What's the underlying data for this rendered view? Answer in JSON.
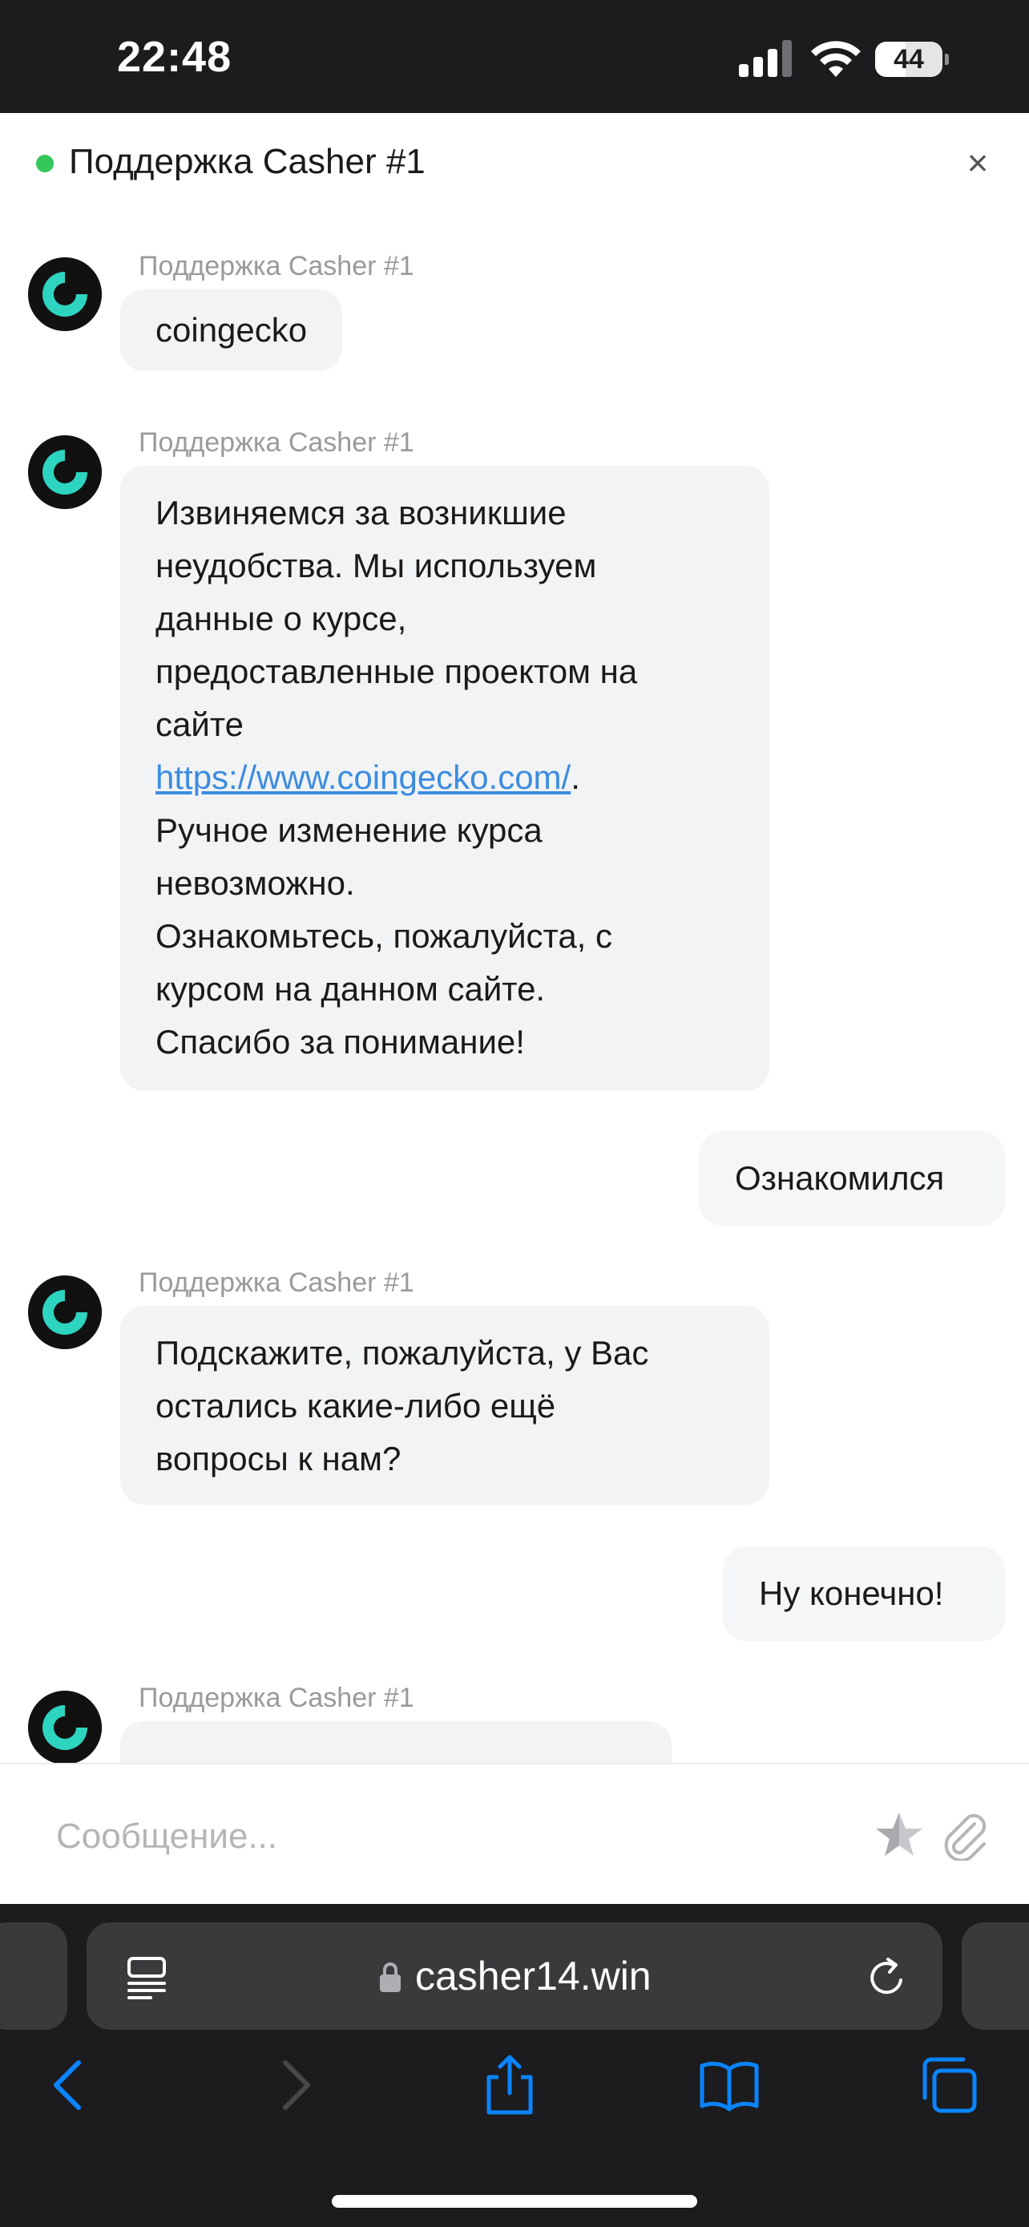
{
  "status_bar": {
    "time": "22:48",
    "battery": "44"
  },
  "chat": {
    "title": "Поддержка Casher #1",
    "close_label": "×",
    "messages": [
      {
        "sender": "Поддержка Casher #1",
        "text": "coingecko"
      },
      {
        "sender": "Поддержка Casher #1",
        "lines": [
          "Извиняемся за возникшие",
          "неудобства. Мы используем",
          "данные о курсе,",
          "предоставленные проектом на",
          "сайте"
        ],
        "link": "https://www.coingecko.com/",
        "link_suffix": ".",
        "lines_after": [
          "Ручное изменение курса",
          "невозможно.",
          "Ознакомьтесь, пожалуйста, с",
          "курсом на данном сайте.",
          "Спасибо за понимание!"
        ]
      },
      {
        "text": "Ознакомился",
        "outgoing": true
      },
      {
        "sender": "Поддержка Casher #1",
        "lines": [
          "Подскажите, пожалуйста, у Вас",
          "остались какие-либо ещё",
          "вопросы к нам?"
        ]
      },
      {
        "text": "Ну конечно!",
        "outgoing": true
      },
      {
        "sender": "Поддержка Casher #1"
      }
    ]
  },
  "input": {
    "placeholder": "Сообщение..."
  },
  "browser": {
    "url": "casher14.win"
  },
  "colors": {
    "accent_teal": "#2dd4bf",
    "link": "#3b8ce0",
    "ios_blue": "#0a84ff",
    "online": "#34c759"
  },
  "icons": [
    "signal-icon",
    "wifi-icon",
    "battery-icon",
    "close-icon",
    "avatar-logo-icon",
    "star-icon",
    "paperclip-icon",
    "reader-icon",
    "lock-icon",
    "reload-icon",
    "back-icon",
    "forward-icon",
    "share-icon",
    "bookmarks-icon",
    "tabs-icon"
  ]
}
